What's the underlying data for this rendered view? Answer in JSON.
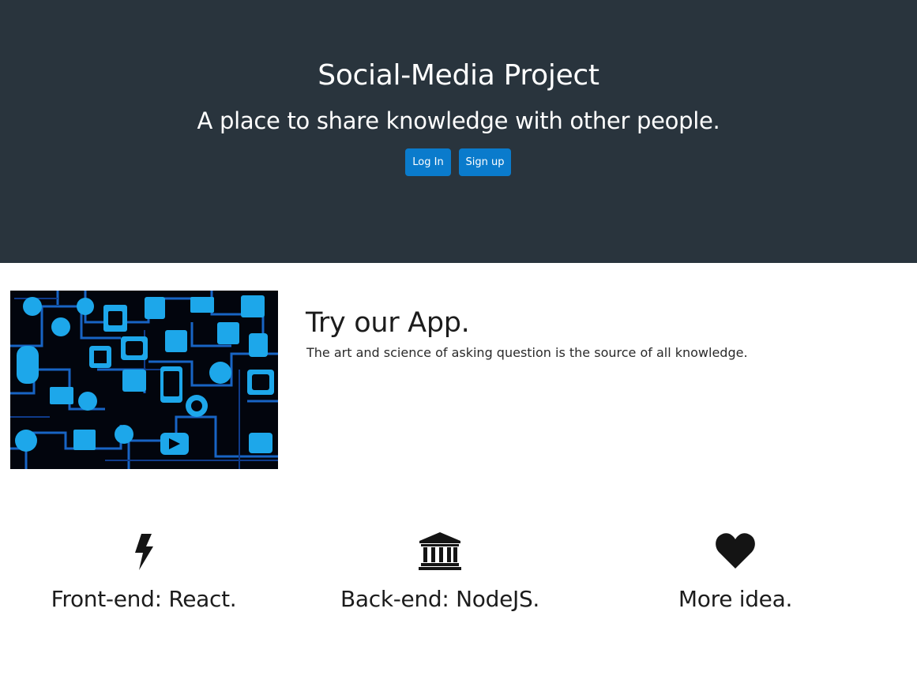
{
  "hero": {
    "title": "Social-Media Project",
    "subtitle": "A place to share knowledge with other people.",
    "login_label": "Log In",
    "signup_label": "Sign up",
    "background_color": "#29343d",
    "button_color": "#0a7bcc"
  },
  "app_section": {
    "image_icon": "social-media-network-icons-image",
    "title": "Try our App.",
    "text": "The art and science of asking question is the source of all knowledge."
  },
  "features": [
    {
      "icon": "bolt-icon",
      "label": "Front-end: React."
    },
    {
      "icon": "bank-icon",
      "label": "Back-end: NodeJS."
    },
    {
      "icon": "heart-icon",
      "label": "More idea."
    }
  ]
}
